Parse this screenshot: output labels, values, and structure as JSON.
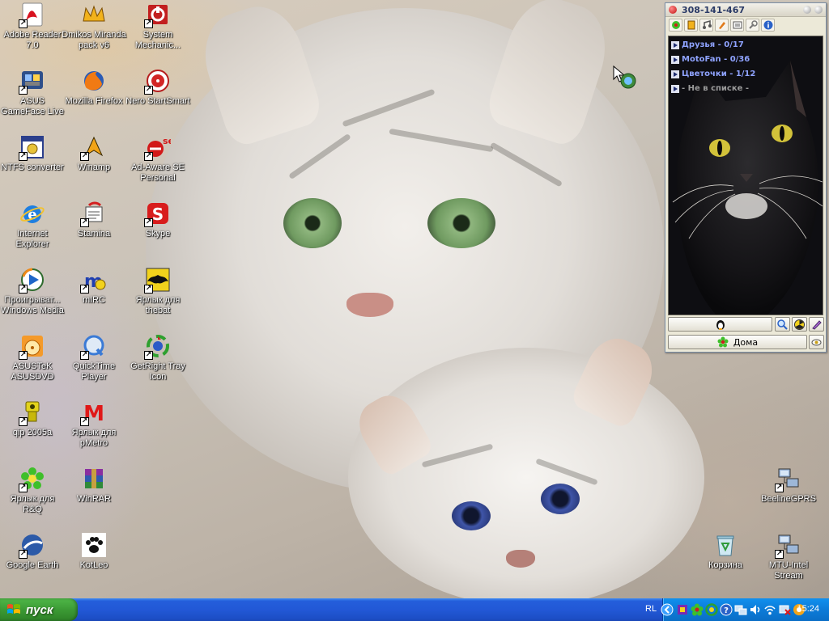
{
  "desktop": {
    "icons": [
      {
        "label": "Adobe Reader 7.0",
        "icon": "adobe-reader-icon"
      },
      {
        "label": "Dmikos Miranda pack v6",
        "icon": "miranda-icon"
      },
      {
        "label": "System Mechanic...",
        "icon": "system-mechanic-icon"
      },
      {
        "label": "ASUS GameFace Live",
        "icon": "asus-gameface-icon"
      },
      {
        "label": "Mozilla Firefox",
        "icon": "firefox-icon"
      },
      {
        "label": "Nero StartSmart",
        "icon": "nero-icon"
      },
      {
        "label": "NTFS converter",
        "icon": "ntfs-converter-icon"
      },
      {
        "label": "Winamp",
        "icon": "winamp-icon"
      },
      {
        "label": "Ad-Aware SE Personal",
        "icon": "ad-aware-icon"
      },
      {
        "label": "Internet Explorer",
        "icon": "internet-explorer-icon"
      },
      {
        "label": "Stamina",
        "icon": "stamina-icon"
      },
      {
        "label": "Skype",
        "icon": "skype-icon"
      },
      {
        "label": "Проигрыват... Windows Media",
        "icon": "windows-media-player-icon"
      },
      {
        "label": "mIRC",
        "icon": "mirc-icon"
      },
      {
        "label": "Ярлык для thebat",
        "icon": "thebat-icon"
      },
      {
        "label": "ASUSTeK ASUSDVD",
        "icon": "asusdvd-icon"
      },
      {
        "label": "QuickTime Player",
        "icon": "quicktime-icon"
      },
      {
        "label": "GetRight Tray Icon",
        "icon": "getright-icon"
      },
      {
        "label": "qip 2005a",
        "icon": "qip-icon"
      },
      {
        "label": "Ярлык для pMetro",
        "icon": "pmetro-icon"
      },
      {
        "label": "Ярлык для R&Q",
        "icon": "rnq-icon"
      },
      {
        "label": "WinRAR",
        "icon": "winrar-icon"
      },
      {
        "label": "Google Earth",
        "icon": "google-earth-icon"
      },
      {
        "label": "KotLeo",
        "icon": "kotleo-icon"
      },
      {
        "label": "BeelineGPRS",
        "icon": "network-connection-icon"
      },
      {
        "label": "Корзина",
        "icon": "recycle-bin-icon"
      },
      {
        "label": "MTU-Intel Stream",
        "icon": "network-connection-icon"
      }
    ]
  },
  "qip": {
    "uin": "308-141-467",
    "groups": [
      {
        "label": "Друзья - 0/17",
        "color": "#8fa3ff"
      },
      {
        "label": "MotoFan - 0/36",
        "color": "#8fa3ff"
      },
      {
        "label": "Цветочки - 1/12",
        "color": "#8fa3ff"
      },
      {
        "label": "- Не в списке -",
        "color": "#9a9a9a"
      }
    ],
    "status_label": "Дома"
  },
  "taskbar": {
    "start_label": "пуск",
    "language": "RL",
    "clock": "15:24"
  },
  "colors": {
    "taskbar": "#245edb",
    "start_button": "#3c9a35",
    "tray": "#0c7bd8"
  }
}
